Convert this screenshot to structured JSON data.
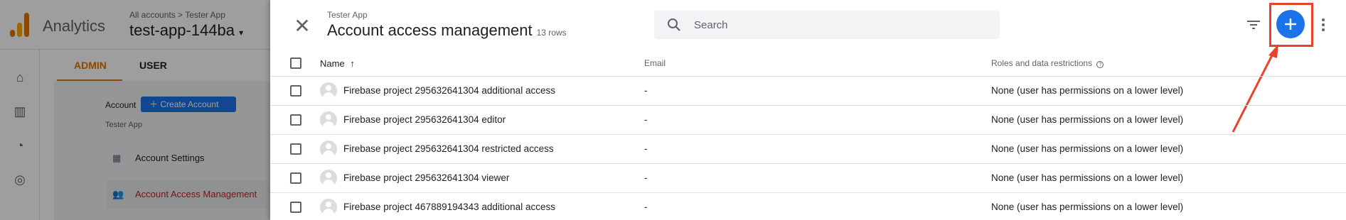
{
  "background_app": {
    "app_name": "Analytics",
    "breadcrumb": {
      "all_accounts": "All accounts",
      "separator": ">",
      "account": "Tester App"
    },
    "property_name": "test-app-144ba",
    "tabs": [
      {
        "label": "ADMIN",
        "active": true
      },
      {
        "label": "USER",
        "active": false
      }
    ],
    "account_label": "Account",
    "create_account_label": "Create Account",
    "account_name": "Tester App",
    "menu": [
      {
        "label": "Account Settings",
        "icon": "building-icon"
      },
      {
        "label": "Account Access Management",
        "icon": "people-icon",
        "selected": true
      }
    ]
  },
  "panel": {
    "subtitle": "Tester App",
    "title": "Account access management",
    "row_count": "13 rows",
    "search": {
      "placeholder": "Search",
      "value": ""
    },
    "columns": {
      "name": "Name",
      "email": "Email",
      "roles": "Roles and data restrictions"
    },
    "rows": [
      {
        "name": "Firebase project 295632641304 additional access",
        "email": "-",
        "roles": "None (user has permissions on a lower level)"
      },
      {
        "name": "Firebase project 295632641304 editor",
        "email": "-",
        "roles": "None (user has permissions on a lower level)"
      },
      {
        "name": "Firebase project 295632641304 restricted access",
        "email": "-",
        "roles": "None (user has permissions on a lower level)"
      },
      {
        "name": "Firebase project 295632641304 viewer",
        "email": "-",
        "roles": "None (user has permissions on a lower level)"
      },
      {
        "name": "Firebase project 467889194343 additional access",
        "email": "-",
        "roles": "None (user has permissions on a lower level)"
      }
    ]
  },
  "colors": {
    "accent_blue": "#1a73e8",
    "highlight_red": "#e8412c",
    "admin_tab_orange": "#e37400",
    "selected_menu_red": "#c5221f"
  }
}
